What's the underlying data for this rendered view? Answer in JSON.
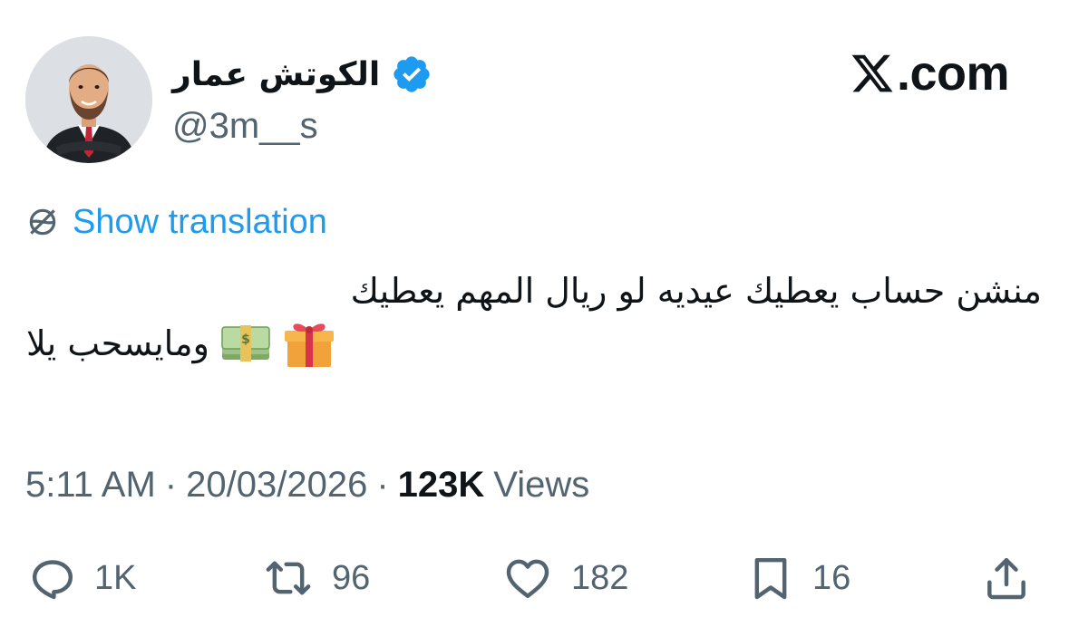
{
  "author": {
    "display_name": "الكوتش عمار",
    "handle": "@3m__s",
    "verified": true,
    "avatar": "avatar-illustration-man-in-suit"
  },
  "site": {
    "logo_text": ".com",
    "logo_icon": "x-logo-icon"
  },
  "translation": {
    "label": "Show translation",
    "icon": "globe-icon"
  },
  "tweet": {
    "line1": "منشن حساب يعطيك عيديه لو ريال المهم يعطيك",
    "line2": "ومايسحب يلا",
    "emojis": [
      "money-bundle-emoji",
      "gift-emoji"
    ]
  },
  "meta": {
    "time": "5:11 AM",
    "date": "20/03/2026",
    "separator": "·",
    "views_count": "123K",
    "views_label": "Views"
  },
  "actions": {
    "reply_count": "1K",
    "repost_count": "96",
    "like_count": "182",
    "bookmark_count": "16"
  },
  "colors": {
    "link": "#1d9bf0",
    "secondary_text": "#536471",
    "primary_text": "#0f1419",
    "verified_badge": "#1d9bf0"
  }
}
